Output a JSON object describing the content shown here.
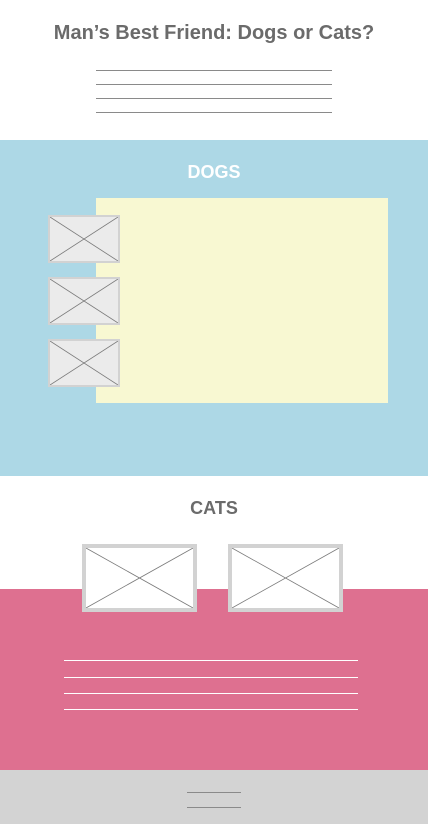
{
  "header": {
    "title": "Man’s Best Friend: Dogs or Cats?",
    "intro_lines": [
      "",
      "",
      "",
      ""
    ]
  },
  "dogs": {
    "heading": "DOGS",
    "background_color": "#add8e6",
    "panel_color": "#f8f8d2",
    "thumbnails": [
      "image-placeholder",
      "image-placeholder",
      "image-placeholder"
    ]
  },
  "cats": {
    "heading": "CATS",
    "background_color": "#de7090",
    "images": [
      "image-placeholder",
      "image-placeholder"
    ],
    "text_lines": [
      "",
      "",
      "",
      ""
    ]
  },
  "footer": {
    "background_color": "#d3d3d3",
    "lines": [
      "",
      ""
    ]
  }
}
